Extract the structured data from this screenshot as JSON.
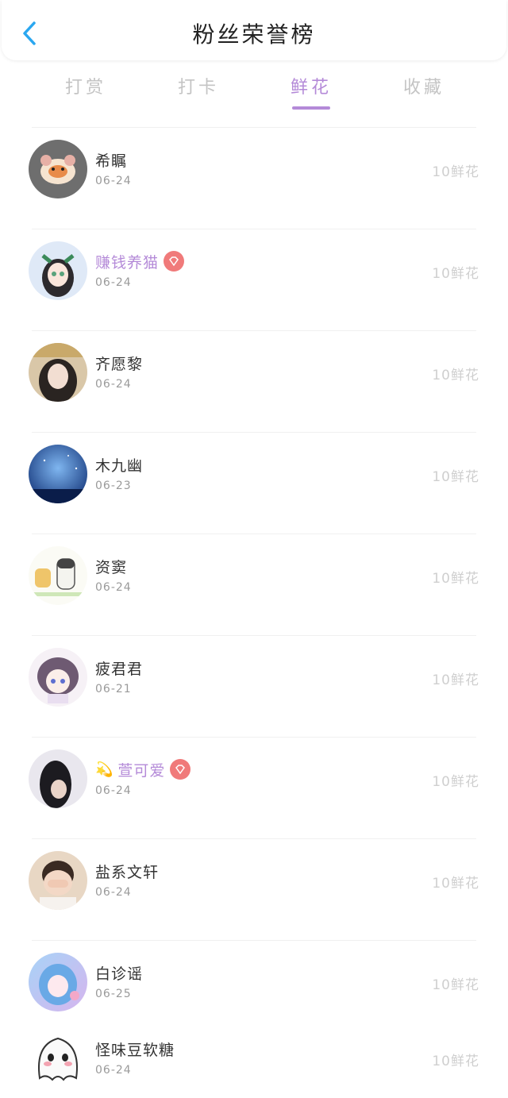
{
  "header": {
    "title": "粉丝荣誉榜",
    "back_icon": "chevron-left-icon",
    "accent": "#2aa7f0"
  },
  "tabs": [
    {
      "label": "打赏",
      "active": false
    },
    {
      "label": "打卡",
      "active": false
    },
    {
      "label": "鲜花",
      "active": true
    },
    {
      "label": "收藏",
      "active": false
    }
  ],
  "colors": {
    "active_tab": "#b48ad8",
    "vip_name": "#b48ad8",
    "badge": "#f07a7a"
  },
  "fans": [
    {
      "name": "希瞩",
      "date": "06-24",
      "gift": "10鲜花",
      "vip": false,
      "avatar": "hamster-avatar"
    },
    {
      "name": "赚钱养猫",
      "date": "06-24",
      "gift": "10鲜花",
      "vip": true,
      "avatar": "anime-girl-avatar"
    },
    {
      "name": "齐愿黎",
      "date": "06-24",
      "gift": "10鲜花",
      "vip": false,
      "avatar": "photo-avatar"
    },
    {
      "name": "木九幽",
      "date": "06-23",
      "gift": "10鲜花",
      "vip": false,
      "avatar": "night-sky-avatar"
    },
    {
      "name": "资窦",
      "date": "06-24",
      "gift": "10鲜花",
      "vip": false,
      "avatar": "cats-avatar"
    },
    {
      "name": "疲君君",
      "date": "06-21",
      "gift": "10鲜花",
      "vip": false,
      "avatar": "anime-boy-avatar"
    },
    {
      "name": "萱可爱",
      "date": "06-24",
      "gift": "10鲜花",
      "vip": true,
      "prefix": "💫",
      "avatar": "girl-photo-avatar"
    },
    {
      "name": "盐系文轩",
      "date": "06-24",
      "gift": "10鲜花",
      "vip": false,
      "avatar": "child-photo-avatar"
    },
    {
      "name": "白诊谣",
      "date": "06-25",
      "gift": "10鲜花",
      "vip": false,
      "avatar": "blue-anime-avatar"
    },
    {
      "name": "怪味豆软糖",
      "date": "06-24",
      "gift": "10鲜花",
      "vip": false,
      "avatar": "ghost-avatar"
    }
  ]
}
